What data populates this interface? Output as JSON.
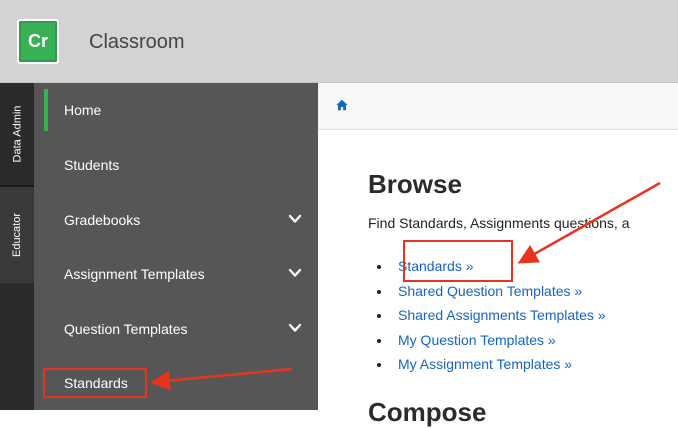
{
  "app": {
    "logo_text": "Cr",
    "title": "Classroom"
  },
  "rail": {
    "tabs": [
      {
        "label": "Data Admin"
      },
      {
        "label": "Educator"
      }
    ]
  },
  "sidebar": {
    "items": [
      {
        "label": "Home",
        "active": true
      },
      {
        "label": "Students"
      },
      {
        "label": "Gradebooks",
        "has_submenu": true
      },
      {
        "label": "Assignment Templates",
        "has_submenu": true
      },
      {
        "label": "Question Templates",
        "has_submenu": true
      },
      {
        "label": "Standards",
        "highlighted": true
      }
    ]
  },
  "breadcrumb": {
    "icon": "home-icon"
  },
  "main": {
    "heading": "Browse",
    "description": "Find Standards, Assignments questions, a",
    "links": [
      {
        "label": "Standards »",
        "highlighted": true
      },
      {
        "label": "Shared Question Templates »"
      },
      {
        "label": "Shared Assignments Templates »"
      },
      {
        "label": "My Question Templates »"
      },
      {
        "label": "My Assignment Templates »"
      }
    ],
    "next_heading": "Compose"
  },
  "colors": {
    "accent_green": "#38b155",
    "annotation_red": "#e8341c",
    "link_blue": "#1565c0",
    "sidebar_bg": "#565656"
  }
}
